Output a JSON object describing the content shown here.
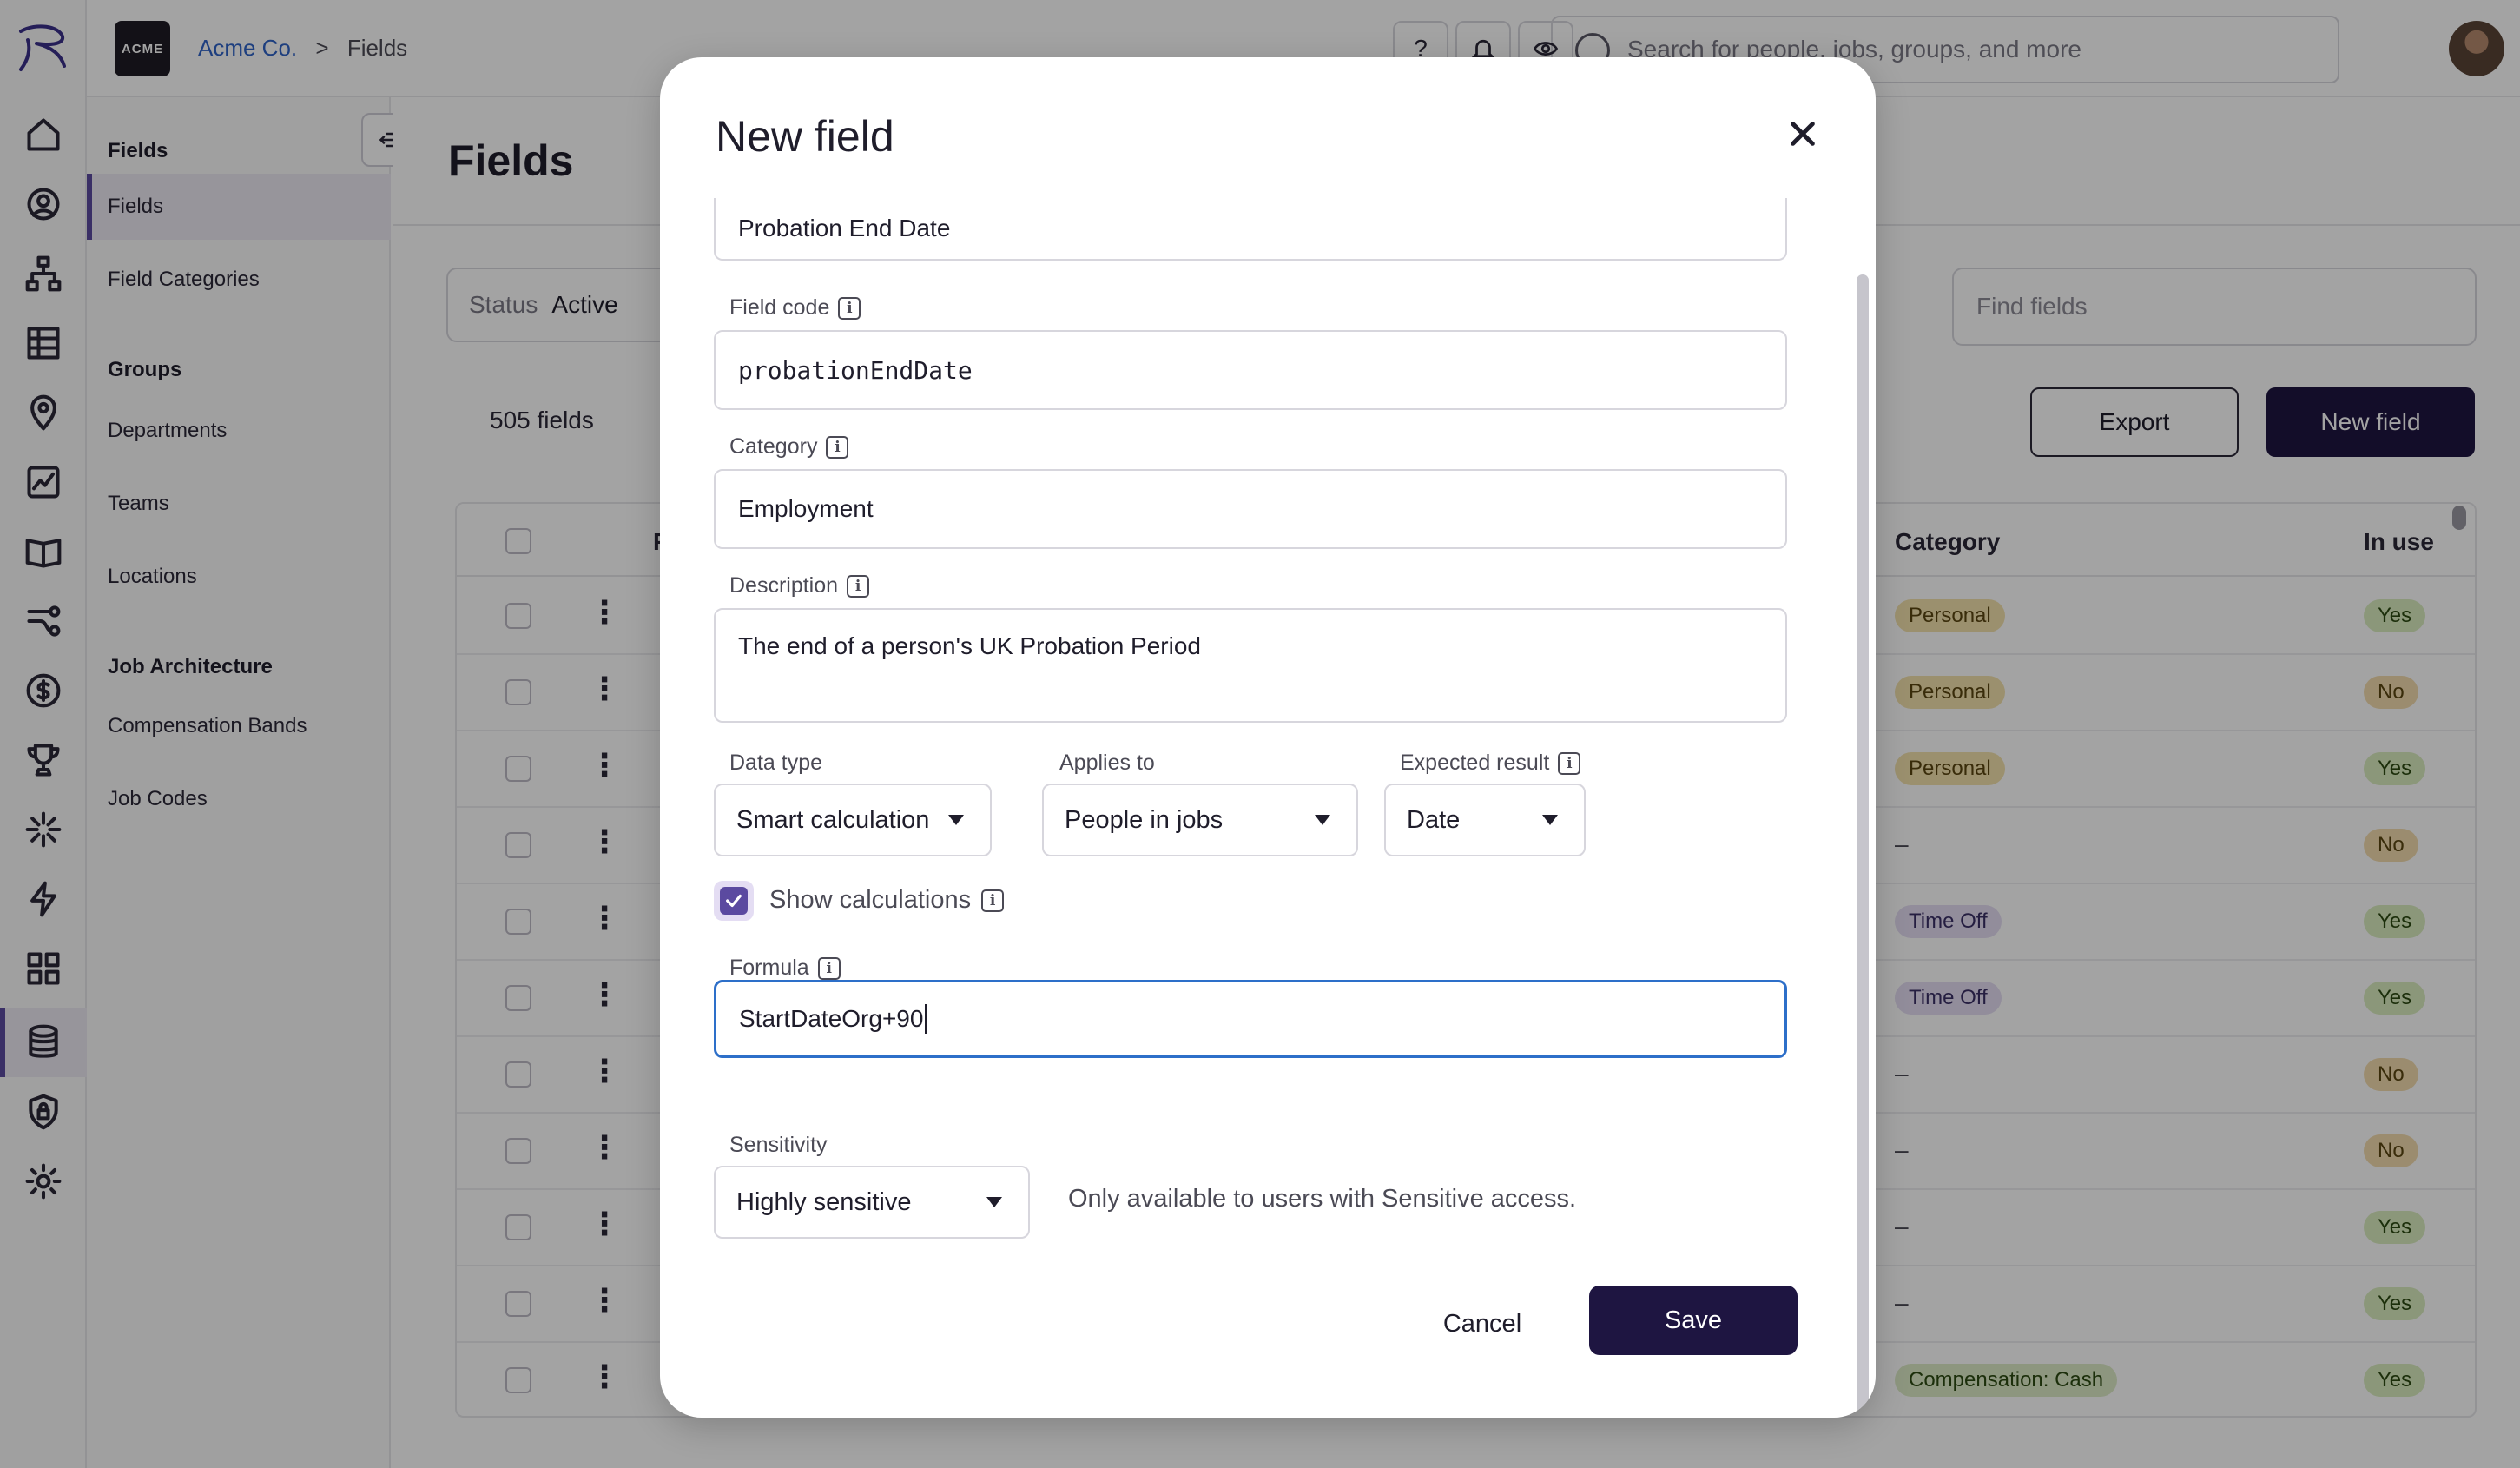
{
  "app": {
    "logo_text": "ACME",
    "breadcrumb": {
      "company": "Acme Co.",
      "separator": ">",
      "current": "Fields"
    },
    "search_placeholder": "Search for people, jobs, groups, and more",
    "help_label": "?"
  },
  "rail": {
    "icons": [
      "home-icon",
      "person-icon",
      "org-chart-icon",
      "list-icon",
      "location-pin-icon",
      "analytics-icon",
      "book-icon",
      "route-icon",
      "dollar-icon",
      "trophy-icon",
      "sparkle-icon",
      "lightning-icon",
      "apps-grid-icon",
      "database-icon",
      "shield-lock-icon",
      "gear-icon"
    ],
    "active": "database-icon"
  },
  "subnav": {
    "sections": [
      {
        "heading": "Fields",
        "items": [
          "Fields",
          "Field Categories"
        ]
      },
      {
        "heading": "Groups",
        "items": [
          "Departments",
          "Teams",
          "Locations"
        ]
      },
      {
        "heading": "Job Architecture",
        "items": [
          "Compensation Bands",
          "Job Codes"
        ]
      }
    ],
    "active_item": "Fields"
  },
  "main": {
    "title": "Fields",
    "status_label": "Status",
    "status_value": "Active",
    "find_placeholder": "Find fields",
    "count": "505 fields",
    "export_label": "Export",
    "new_field_label": "New field",
    "columns": {
      "name_fragment": "F",
      "category": "Category",
      "in_use": "In use"
    },
    "rows": [
      {
        "category": "Personal",
        "in_use": "Yes"
      },
      {
        "category": "Personal",
        "in_use": "No"
      },
      {
        "category": "Personal",
        "in_use": "Yes"
      },
      {
        "category": "–",
        "in_use": "No"
      },
      {
        "category": "Time Off",
        "in_use": "Yes"
      },
      {
        "category": "Time Off",
        "in_use": "Yes"
      },
      {
        "category": "–",
        "in_use": "No"
      },
      {
        "category": "–",
        "in_use": "No"
      },
      {
        "category": "–",
        "in_use": "Yes"
      },
      {
        "category": "–",
        "in_use": "Yes"
      },
      {
        "category": "Compensation: Cash",
        "in_use": "Yes"
      }
    ]
  },
  "modal": {
    "title": "New field",
    "name_value": "Probation End Date",
    "field_code_label": "Field code",
    "field_code_value": "probationEndDate",
    "category_label": "Category",
    "category_value": "Employment",
    "description_label": "Description",
    "description_value": "The end of a person's UK Probation Period",
    "data_type_label": "Data type",
    "data_type_value": "Smart calculation",
    "applies_to_label": "Applies to",
    "applies_to_value": "People in jobs",
    "expected_result_label": "Expected result",
    "expected_result_value": "Date",
    "show_calculations_label": "Show calculations",
    "show_calculations_checked": true,
    "formula_label": "Formula",
    "formula_value": "StartDateOrg+90",
    "sensitivity_label": "Sensitivity",
    "sensitivity_value": "Highly sensitive",
    "sensitivity_note": "Only available to users with Sensitive access.",
    "cancel_label": "Cancel",
    "save_label": "Save"
  },
  "colors": {
    "brand_dark": "#1e1541",
    "accent_purple": "#5b4aa0",
    "focus_blue": "#2d6fc9",
    "link_blue": "#2f63c7"
  }
}
